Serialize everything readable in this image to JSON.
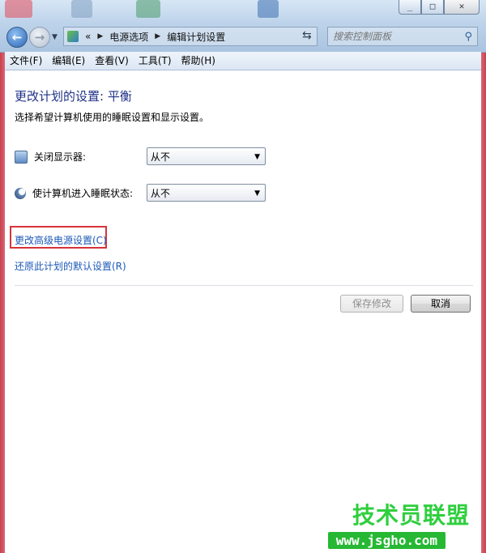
{
  "window": {
    "minimize_icon": "minimize-icon",
    "maximize_icon": "maximize-icon",
    "close_icon": "close-icon"
  },
  "address_bar": {
    "overflow": "«",
    "crumbs": [
      "电源选项",
      "编辑计划设置"
    ]
  },
  "search": {
    "placeholder": "搜索控制面板"
  },
  "menu": [
    "文件(F)",
    "编辑(E)",
    "查看(V)",
    "工具(T)",
    "帮助(H)"
  ],
  "main": {
    "title": "更改计划的设置: 平衡",
    "description": "选择希望计算机使用的睡眠设置和显示设置。",
    "settings": [
      {
        "label": "关闭显示器:",
        "value": "从不",
        "icon": "monitor-icon"
      },
      {
        "label": "使计算机进入睡眠状态:",
        "value": "从不",
        "icon": "moon-sleep-icon"
      }
    ],
    "links": {
      "advanced": "更改高级电源设置(C)",
      "restore": "还原此计划的默认设置(R)"
    },
    "buttons": {
      "save": "保存修改",
      "cancel": "取消"
    }
  },
  "watermark": {
    "title": "技术员联盟",
    "url": "www.jsgho.com"
  },
  "colors": {
    "title_blue": "#1e3287",
    "link_blue": "#1b58b8",
    "highlight_red": "#d7333a",
    "watermark_green": "#26b833"
  }
}
